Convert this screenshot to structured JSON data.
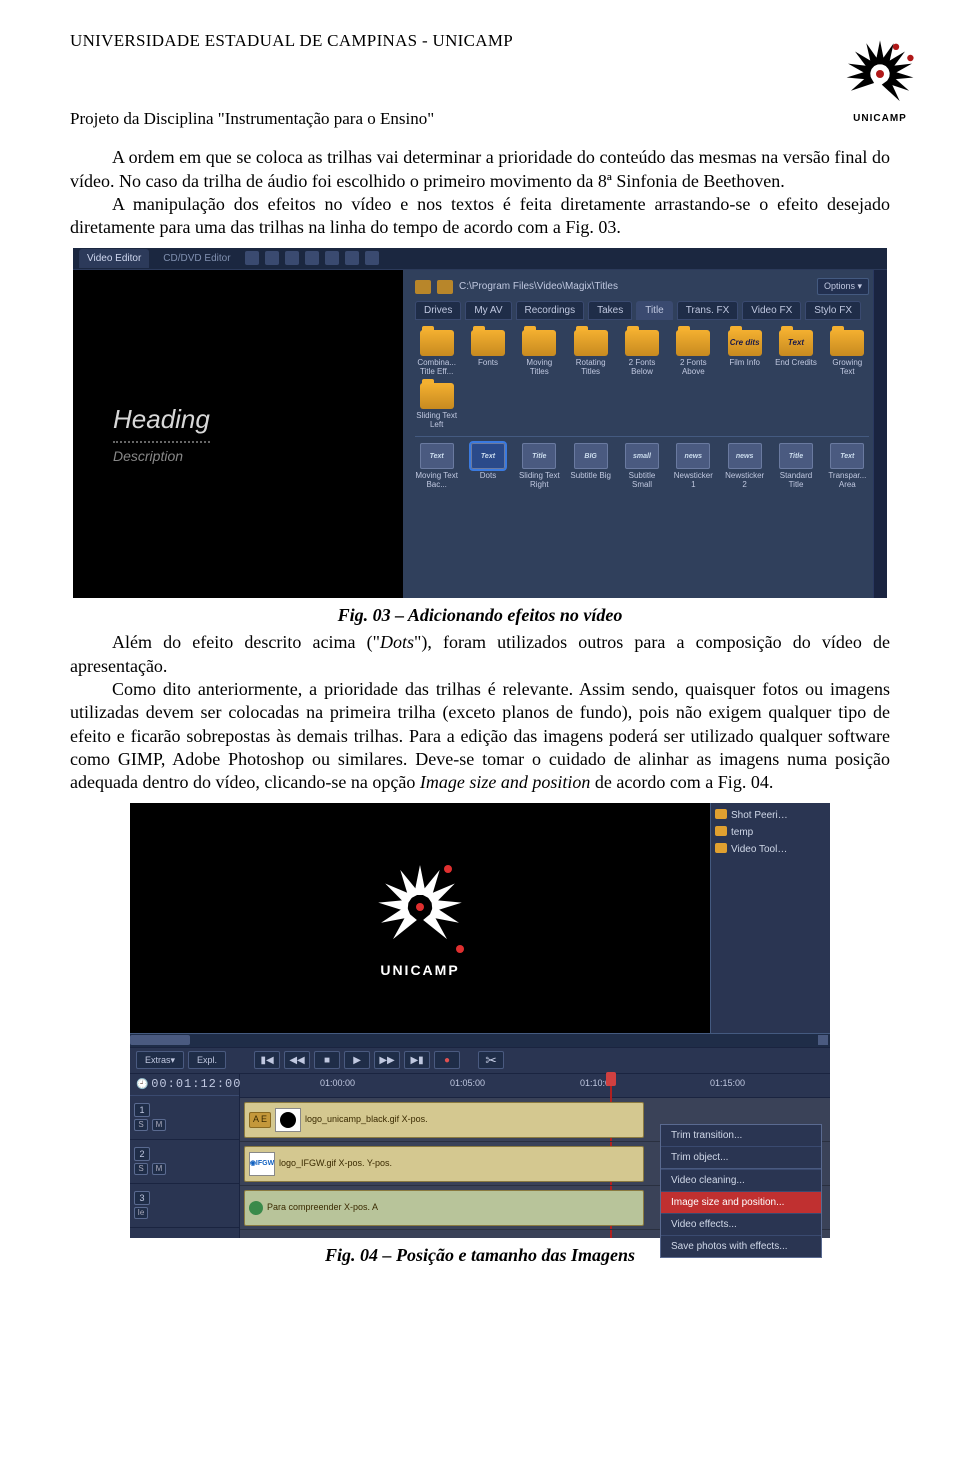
{
  "header": {
    "university": "UNIVERSIDADE ESTADUAL DE CAMPINAS - UNICAMP",
    "project_line": "Projeto da Disciplina \"Instrumentação para o Ensino\"",
    "logo_label": "UNICAMP"
  },
  "body_text": {
    "p1": "A ordem em que se coloca as trilhas vai determinar a prioridade do conteúdo das mesmas na versão final do vídeo. No caso da trilha de áudio foi escolhido o primeiro movimento da 8ª Sinfonia de Beethoven.",
    "p2": "A manipulação dos efeitos no vídeo e nos textos é feita diretamente arrastando-se o efeito desejado diretamente para uma das trilhas na linha do tempo de acordo com a Fig. 03.",
    "caption1": "Fig. 03 – Adicionando efeitos no vídeo",
    "p3a": "Além do efeito descrito acima (\"",
    "p3_dots": "Dots",
    "p3b": "\"), foram utilizados outros para a composição do vídeo de apresentação.",
    "p4": "Como dito anteriormente, a prioridade das trilhas é relevante. Assim sendo, quaisquer fotos ou imagens utilizadas devem ser colocadas na primeira trilha (exceto planos de fundo), pois não exigem qualquer tipo de efeito e ficarão sobrepostas às demais trilhas. Para a edição das imagens poderá ser utilizado qualquer software como GIMP, Adobe Photoshop ou similares. Deve-se tomar o cuidado de alinhar as imagens numa posição adequada dentro do vídeo, clicando-se na opção ",
    "p4_italic": "Image size and position",
    "p4_end": " de acordo com a Fig. 04.",
    "caption2": "Fig. 04 – Posição e tamanho das Imagens"
  },
  "fig1": {
    "tabs": {
      "video": "Video Editor",
      "cd": "CD/DVD Editor"
    },
    "path": "C:\\Program Files\\Video\\Magix\\Titles",
    "options": "Options",
    "categories": [
      "Drives",
      "My AV",
      "Recordings",
      "Takes",
      "Title",
      "Trans. FX",
      "Video FX",
      "Stylo FX"
    ],
    "row1": [
      {
        "label": "Combina... Title Eff...",
        "type": "folder"
      },
      {
        "label": "Fonts",
        "type": "folder"
      },
      {
        "label": "Moving Titles",
        "type": "folder"
      },
      {
        "label": "Rotating Titles",
        "type": "folder"
      },
      {
        "label": "2 Fonts Below",
        "type": "folder"
      },
      {
        "label": "2 Fonts Above",
        "type": "folder"
      },
      {
        "label": "Film Info",
        "type": "folder",
        "fx": "Cre dits"
      },
      {
        "label": "End Credits",
        "type": "folder",
        "fx": "Text"
      },
      {
        "label": "Growing Text",
        "type": "folder"
      },
      {
        "label": "Sliding Text Left",
        "type": "folder"
      }
    ],
    "row2": [
      {
        "label": "Moving Text Bac...",
        "tile": "Text"
      },
      {
        "label": "Dots",
        "tile": "Text",
        "selected": true
      },
      {
        "label": "Sliding Text Right",
        "tile": "Title"
      },
      {
        "label": "Subtitle Big",
        "tile": "BIG"
      },
      {
        "label": "Subtitle Small",
        "tile": "small"
      },
      {
        "label": "Newsticker 1",
        "tile": "news"
      },
      {
        "label": "Newsticker 2",
        "tile": "news"
      },
      {
        "label": "Standard Title",
        "tile": "Title"
      },
      {
        "label": "Transpar... Area",
        "tile": "Text"
      }
    ],
    "preview": {
      "heading": "Heading",
      "desc": "Description"
    }
  },
  "fig2": {
    "side_folders": [
      "Shot Peeri…",
      "temp",
      "Video Tool…"
    ],
    "logo_text": "UNICAMP",
    "extras": "Extras",
    "expl": "Expl.",
    "timecode": "00:01:12:00",
    "ruler": [
      "01:00:00",
      "01:05:00",
      "01:10:00",
      "01:15:00"
    ],
    "tracks": [
      {
        "num": "1",
        "clip_label": "logo_unicamp_black.gif  X-pos."
      },
      {
        "num": "2",
        "clip_label": "logo_IFGW.gif  X-pos.  Y-pos."
      },
      {
        "num": "3",
        "clip_label": "Para compreender  X-pos. A"
      }
    ],
    "track_btns": [
      "S",
      "M"
    ],
    "track_badge": "Ie",
    "clip_ae": "A E",
    "ifgw_thumb": "IFGW",
    "context_menu": [
      "Trim transition...",
      "Trim object...",
      "Video cleaning...",
      "Image size and position...",
      "Video effects...",
      "Save photos with effects..."
    ],
    "context_selected_index": 3
  }
}
